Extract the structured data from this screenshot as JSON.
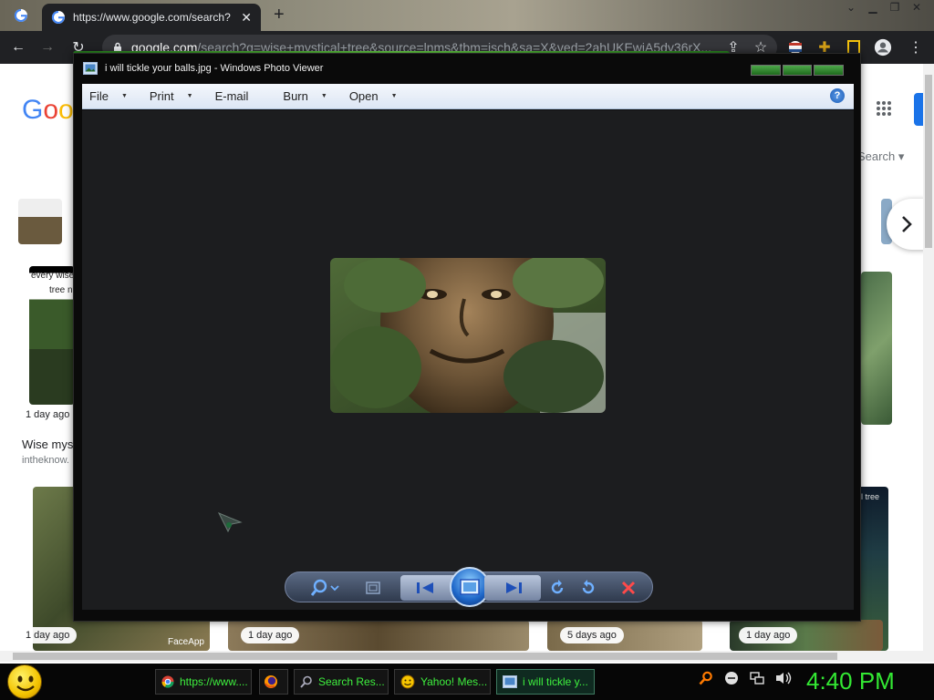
{
  "browser": {
    "active_tab_title": "https://www.google.com/search?",
    "new_tab_symbol": "+",
    "url_host": "google.com",
    "url_path": "/search?q=wise+mystical+tree&source=lnms&tbm=isch&sa=X&ved=2ahUKEwiA5dy36rX..."
  },
  "google": {
    "logo": "Goo",
    "search_tools": "Search",
    "results": [
      {
        "time": "1 day ago",
        "caption_top": "every wise",
        "caption_bottom": "tree n"
      },
      {
        "time": "1 day ago",
        "watermark": "FaceApp"
      },
      {
        "time": "1 day ago"
      },
      {
        "time": "5 days ago"
      },
      {
        "time": "1 day ago"
      }
    ],
    "right_caption": "l tree",
    "result_title": "Wise myst",
    "result_source": "intheknow."
  },
  "photo_viewer": {
    "title": "i will tickle your balls.jpg - Windows Photo Viewer",
    "menus": [
      {
        "label": "File",
        "caret": "▼"
      },
      {
        "label": "Print",
        "caret": "▼"
      },
      {
        "label": "E-mail",
        "caret": ""
      },
      {
        "label": "Burn",
        "caret": "▼"
      },
      {
        "label": "Open",
        "caret": "▼"
      }
    ],
    "help": "?"
  },
  "taskbar": {
    "items": [
      {
        "label": "https://www...."
      },
      {
        "label": ""
      },
      {
        "label": "Search Res..."
      },
      {
        "label": "Yahoo! Mes..."
      },
      {
        "label": "i will tickle y..."
      }
    ],
    "clock": "4:40 PM"
  },
  "colors": {
    "google_blue": "#4285F4",
    "google_red": "#EA4335",
    "google_yellow": "#FBBC05",
    "taskbar_text": "#3ef03e",
    "photo_viewer_canvas": "#1c1d1f"
  }
}
